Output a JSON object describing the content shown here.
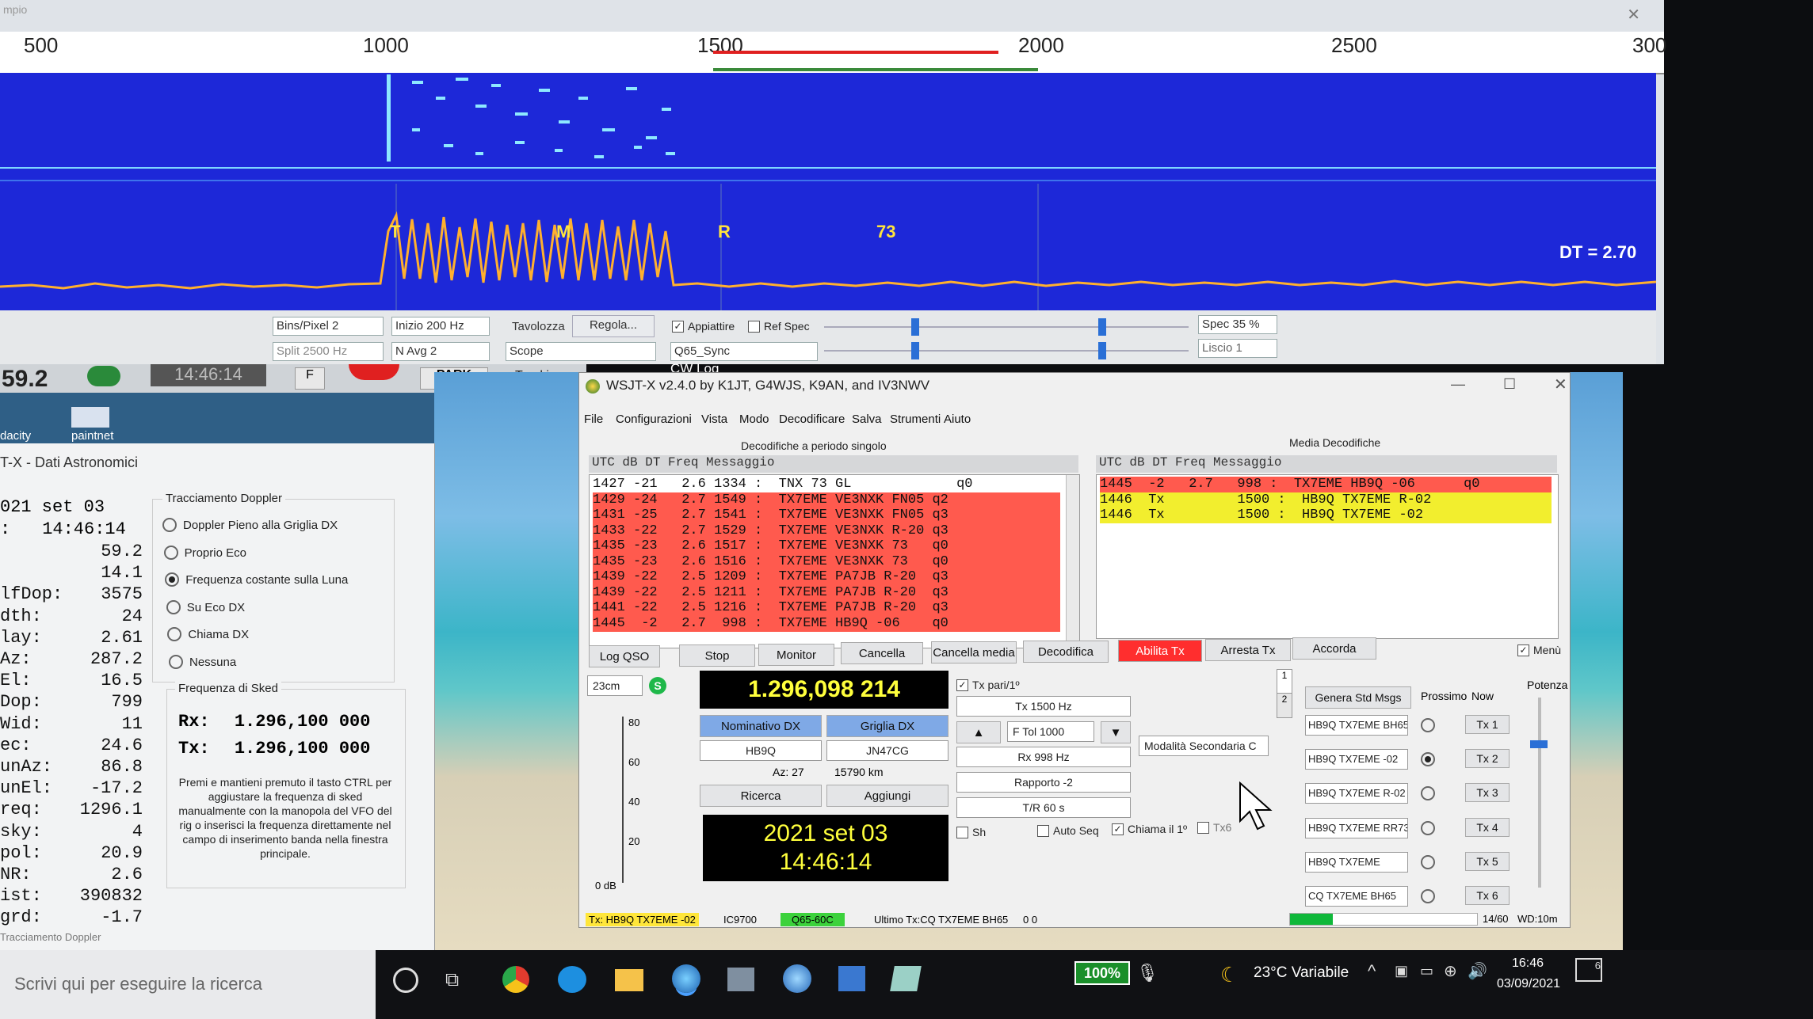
{
  "waterfall": {
    "top_label": "mpio",
    "freq_ticks": [
      "500",
      "1000",
      "1500",
      "2000",
      "2500",
      "300"
    ],
    "markers": [
      "T",
      "M",
      "R",
      "73"
    ],
    "dt_readout": "DT = 2.70",
    "controls": {
      "bins_pixel": "Bins/Pixel  2",
      "inizio": "Inizio 200 Hz",
      "tavolozza": "Tavolozza",
      "regola": "Regola...",
      "appiattire": "Appiattire",
      "ref_spec": "Ref Spec",
      "spec": "Spec 35 %",
      "split": "Split  2500  Hz",
      "n_avg": "N Avg 2",
      "scope": "Scope",
      "sync": "Q65_Sync",
      "liscio": "Liscio  1"
    }
  },
  "behind": {
    "big_time": "14:46:14",
    "freq_partial": "59.2",
    "f_btn": "F",
    "park_btn": "PARK",
    "tracking": "Tracking",
    "cw_log": "CW Log",
    "desktop_icons": [
      "dacity",
      "paintnet"
    ]
  },
  "astro": {
    "title": "T-X - Dati Astronomici",
    "date": "021 set 03",
    "time": "14:46:14",
    "rows": [
      {
        "k": "",
        "v": "59.2"
      },
      {
        "k": "",
        "v": "14.1"
      },
      {
        "k": "lfDop:",
        "v": "3575"
      },
      {
        "k": "dth:",
        "v": "24"
      },
      {
        "k": "lay:",
        "v": "2.61"
      },
      {
        "k": "Az:",
        "v": "287.2"
      },
      {
        "k": "El:",
        "v": "16.5"
      },
      {
        "k": "Dop:",
        "v": "799"
      },
      {
        "k": "Wid:",
        "v": "11"
      },
      {
        "k": "ec:",
        "v": "24.6"
      },
      {
        "k": "unAz:",
        "v": "86.8"
      },
      {
        "k": "unEl:",
        "v": "-17.2"
      },
      {
        "k": "req:",
        "v": "1296.1"
      },
      {
        "k": "sky:",
        "v": "4"
      },
      {
        "k": "pol:",
        "v": "20.9"
      },
      {
        "k": "NR:",
        "v": "2.6"
      },
      {
        "k": "ist:",
        "v": "390832"
      },
      {
        "k": "grd:",
        "v": "-1.7"
      }
    ],
    "doppler_title": "Tracciamento Doppler",
    "doppler_options": [
      {
        "label": "Doppler Pieno alla Griglia DX",
        "selected": false
      },
      {
        "label": "Proprio Eco",
        "selected": false
      },
      {
        "label": "Frequenza costante sulla Luna",
        "selected": true
      },
      {
        "label": "Su Eco DX",
        "selected": false
      },
      {
        "label": "Chiama DX",
        "selected": false
      },
      {
        "label": "Nessuna",
        "selected": false
      }
    ],
    "sked_title": "Frequenza di Sked",
    "rx_label": "Rx:",
    "rx_value": "1.296,100 000",
    "tx_label": "Tx:",
    "tx_value": "1.296,100 000",
    "help_text": "Premi e mantieni premuto il tasto CTRL per aggiustare la frequenza di sked manualmente con la manopola del VFO del rig o inserisci la frequenza direttamente nel campo di inserimento banda nella finestra principale.",
    "footer": "Tracciamento Doppler"
  },
  "wsjt": {
    "title": "WSJT-X   v2.4.0   by K1JT, G4WJS, K9AN, and IV3NWV",
    "menu": [
      "File",
      "Configurazioni",
      "Vista",
      "Modo",
      "Decodificare",
      "Salva",
      "Strumenti",
      "Aiuto"
    ],
    "left_title": "Decodifiche a periodo singolo",
    "right_title": "Media Decodifiche",
    "header_cols": "UTC    dB    DT  Freq       Messaggio",
    "left_lines": [
      {
        "text": "1427 -21   2.6 1334 :  TNX 73 GL             q0",
        "hl": "none"
      },
      {
        "text": "1429 -24   2.7 1549 :  TX7EME VE3NXK FN05 q2",
        "hl": "red"
      },
      {
        "text": "1431 -25   2.7 1541 :  TX7EME VE3NXK FN05 q3",
        "hl": "red"
      },
      {
        "text": "1433 -22   2.7 1529 :  TX7EME VE3NXK R-20 q3",
        "hl": "red"
      },
      {
        "text": "1435 -23   2.6 1517 :  TX7EME VE3NXK 73   q0",
        "hl": "red"
      },
      {
        "text": "1435 -23   2.6 1516 :  TX7EME VE3NXK 73   q0",
        "hl": "red"
      },
      {
        "text": "1439 -22   2.5 1209 :  TX7EME PA7JB R-20  q3",
        "hl": "red"
      },
      {
        "text": "1439 -22   2.5 1211 :  TX7EME PA7JB R-20  q3",
        "hl": "red"
      },
      {
        "text": "1441 -22   2.5 1216 :  TX7EME PA7JB R-20  q3",
        "hl": "red"
      },
      {
        "text": "1445  -2   2.7  998 :  TX7EME HB9Q -06    q0",
        "hl": "red"
      }
    ],
    "right_lines": [
      {
        "text": "1445  -2   2.7   998 :  TX7EME HB9Q -06      q0",
        "hl": "red"
      },
      {
        "text": "1446  Tx         1500 :  HB9Q TX7EME R-02",
        "hl": "yellow"
      },
      {
        "text": "1446  Tx         1500 :  HB9Q TX7EME -02",
        "hl": "yellow"
      }
    ],
    "buttons": [
      "Log QSO",
      "Stop",
      "Monitor",
      "Cancella",
      "Cancella media",
      "Decodifica",
      "Abilita Tx",
      "Arresta Tx",
      "Accorda"
    ],
    "menu_cb": "Menù",
    "band": "23cm",
    "s_badge": "S",
    "frequency": "1.296,098 214",
    "tx_pari": "Tx pari/1º",
    "tx_freq": "Tx  1500  Hz",
    "ftol": "F Tol  1000",
    "rx_freq": "Rx  998  Hz",
    "rapporto": "Rapporto -2",
    "tr": "T/R  60  s",
    "modalita": "Modalità Secondaria C",
    "sh": "Sh",
    "auto_seq": "Auto Seq",
    "chiama": "Chiama il 1º",
    "tx6cb": "Tx6",
    "nominativo_label": "Nominativo DX",
    "griglia_label": "Griglia DX",
    "dx_call": "HB9Q",
    "dx_grid": "JN47CG",
    "az": "Az: 27",
    "dist": "15790 km",
    "ricerca": "Ricerca",
    "aggiungi": "Aggiungi",
    "date": "2021 set 03",
    "time": "14:46:14",
    "meter_ticks": [
      "80",
      "60",
      "40",
      "20",
      "0 dB"
    ],
    "genera": "Genera Std Msgs",
    "prossimo": "Prossimo",
    "now": "Now",
    "potenza": "Potenza",
    "msgs": [
      {
        "text": "HB9Q TX7EME BH65",
        "btn": "Tx 1",
        "sel": false
      },
      {
        "text": "HB9Q TX7EME -02",
        "btn": "Tx 2",
        "sel": true
      },
      {
        "text": "HB9Q TX7EME R-02",
        "btn": "Tx 3",
        "sel": false
      },
      {
        "text": "HB9Q TX7EME RR73",
        "btn": "Tx 4",
        "sel": false
      },
      {
        "text": "HB9Q TX7EME",
        "btn": "Tx 5",
        "sel": false
      },
      {
        "text": "CQ TX7EME BH65",
        "btn": "Tx 6",
        "sel": false
      }
    ],
    "status": {
      "tx_msg": "Tx: HB9Q TX7EME -02",
      "rig": "IC9700",
      "mode": "Q65-60C",
      "last_tx": "Ultimo Tx:CQ TX7EME BH65",
      "counts": "0  0",
      "progress": "14/60",
      "wd": "WD:10m",
      "progress_fraction": 0.23
    },
    "side_tabs": [
      "1",
      "2"
    ]
  },
  "taskbar": {
    "search": "Scrivi qui per eseguire la ricerca",
    "battery": "100%",
    "weather": "23°C  Variabile",
    "time": "16:46",
    "date": "03/09/2021",
    "notif": "6"
  },
  "colors": {
    "waterfall_blue": "#1d28d8",
    "decode_red": "#ff5a4e",
    "decode_yellow": "#f2ee2e",
    "abilita_red": "#ff2e2e",
    "lcd_yellow": "#ffff3c"
  }
}
